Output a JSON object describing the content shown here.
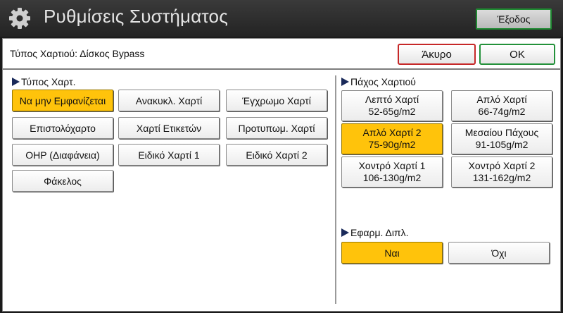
{
  "titlebar": {
    "icon": "gear-icon",
    "title": "Ρυθμίσεις Συστήματος",
    "exit_label": "Έξοδος"
  },
  "header": {
    "title": "Τύπος Χαρτιού: Δίσκος Bypass",
    "cancel_label": "Άκυρο",
    "ok_label": "OK"
  },
  "paper_type": {
    "label": "Τύπος Χαρτ.",
    "options": [
      {
        "label": "Να μην Εμφανίζεται",
        "selected": true
      },
      {
        "label": "Ανακυκλ. Χαρτί",
        "selected": false
      },
      {
        "label": "Έγχρωμο Χαρτί",
        "selected": false
      },
      {
        "label": "Επιστολόχαρτο",
        "selected": false
      },
      {
        "label": "Χαρτί Ετικετών",
        "selected": false
      },
      {
        "label": "Προτυπωμ. Χαρτί",
        "selected": false
      },
      {
        "label": "OHP (Διαφάνεια)",
        "selected": false
      },
      {
        "label": "Ειδικό Χαρτί 1",
        "selected": false
      },
      {
        "label": "Ειδικό Χαρτί 2",
        "selected": false
      },
      {
        "label": "Φάκελος",
        "selected": false
      }
    ]
  },
  "thickness": {
    "label": "Πάχος Χαρτιού",
    "options": [
      {
        "name": "Λεπτό Χαρτί",
        "range": "52-65g/m2",
        "selected": false
      },
      {
        "name": "Απλό Χαρτί",
        "range": "66-74g/m2",
        "selected": false
      },
      {
        "name": "Απλό Χαρτί 2",
        "range": "75-90g/m2",
        "selected": true
      },
      {
        "name": "Μεσαίου Πάχους",
        "range": "91-105g/m2",
        "selected": false
      },
      {
        "name": "Χοντρό Χαρτί 1",
        "range": "106-130g/m2",
        "selected": false
      },
      {
        "name": "Χοντρό Χαρτί 2",
        "range": "131-162g/m2",
        "selected": false
      }
    ]
  },
  "duplex": {
    "label": "Εφαρμ. Διπλ.",
    "yes_label": "Ναι",
    "no_label": "Όχι",
    "selected": "yes"
  },
  "colors": {
    "selected": "#ffc30b",
    "cancel_border": "#c62828",
    "ok_border": "#23913a"
  }
}
